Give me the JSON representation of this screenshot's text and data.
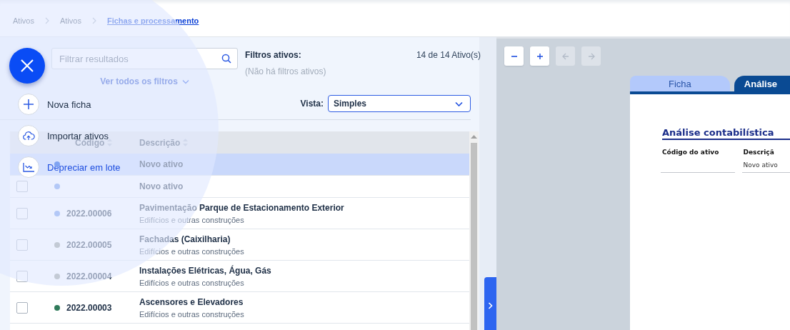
{
  "breadcrumb": [
    {
      "label": "Ativos",
      "current": false
    },
    {
      "label": "Ativos",
      "current": false
    },
    {
      "label": "Fichas e processamento",
      "current": true
    }
  ],
  "search": {
    "placeholder": "Filtrar resultados"
  },
  "filters_link": "Ver todos os filtros",
  "active_filters": {
    "label": "Filtros ativos:",
    "empty_text": "(Não há filtros ativos)"
  },
  "count": "14 de 14 Ativo(s)",
  "view": {
    "label": "Vista:",
    "value": "Simples"
  },
  "table": {
    "columns": [
      "Código",
      "Descrição"
    ],
    "rows": [
      {
        "selected": true,
        "color": "#7fa3f2",
        "title": "Novo ativo"
      },
      {
        "selected": false,
        "checked": false,
        "color": "#b3c8f7",
        "title": "Novo ativo"
      },
      {
        "selected": false,
        "checked": false,
        "color": "#b3c8f7",
        "code": "2022.00006",
        "title": "Pavimentação Parque de Estacionamento Exterior",
        "subtitle": "Edifícios e outras construções"
      },
      {
        "selected": false,
        "checked": false,
        "color": "#c3cad5",
        "code": "2022.00005",
        "title": "Fachadas (Caixilharia)",
        "subtitle": "Edifícios e outras construções"
      },
      {
        "selected": false,
        "checked": false,
        "color": "#c3cad5",
        "code": "2022.00004",
        "title": "Instalações Elétricas, Água, Gás",
        "subtitle": "Edifícios e outras construções"
      },
      {
        "selected": false,
        "checked": false,
        "color": "#2f7a5a",
        "code": "2022.00003",
        "title": "Ascensores e Elevadores",
        "subtitle": "Edifícios e outras construções"
      }
    ]
  },
  "viewer": {
    "toolbar": [
      {
        "kind": "zoom-out",
        "disabled": false
      },
      {
        "kind": "zoom-in",
        "disabled": false
      },
      {
        "kind": "back",
        "disabled": true
      },
      {
        "kind": "forward",
        "disabled": true
      }
    ],
    "tabs": [
      {
        "label": "Ficha",
        "selected": false
      },
      {
        "label": "Análise",
        "selected": true
      }
    ],
    "heading": "Análise contabilística",
    "fields": [
      {
        "label": "Código do ativo"
      },
      {
        "label": "Descriçã",
        "value": "Novo ativo"
      }
    ]
  },
  "fab_menu": {
    "items": [
      {
        "kind": "add",
        "label": "Nova ficha",
        "highlighted": false
      },
      {
        "kind": "upload",
        "label": "Importar ativos",
        "highlighted": false
      },
      {
        "kind": "chart",
        "label": "Depreciar em lote",
        "highlighted": true
      }
    ]
  }
}
